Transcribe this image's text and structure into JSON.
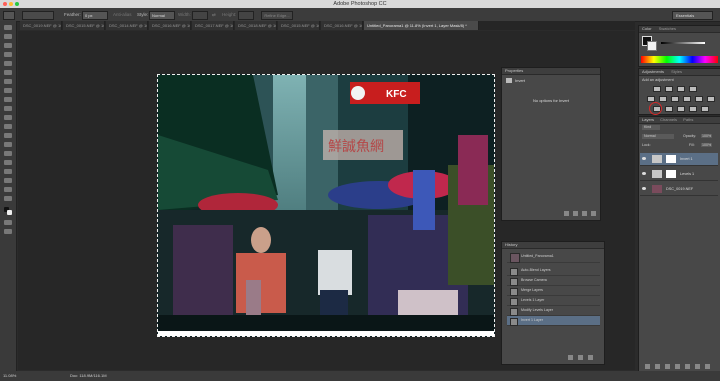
{
  "app": {
    "title": "Adobe Photoshop CC"
  },
  "options_bar": {
    "feather_label": "Feather:",
    "feather_value": "0 px",
    "antialias_label": "Anti-alias",
    "style_label": "Style:",
    "style_value": "Normal",
    "width_label": "Width:",
    "height_label": "Height:",
    "refine_edge_label": "Refine Edge...",
    "workspace": "Essentials"
  },
  "tabs": [
    {
      "label": "DSC_0019.NEF @ 16..."
    },
    {
      "label": "DSC_0015.NEF @ 16..."
    },
    {
      "label": "DSC_0014.NEF @ 16..."
    },
    {
      "label": "DSC_0016.NEF @ 16..."
    },
    {
      "label": "DSC_0017.NEF @ 16..."
    },
    {
      "label": "DSC_0018.NEF @ 16..."
    },
    {
      "label": "DSC_0015.NEF @ 16..."
    },
    {
      "label": "DSC_0016.NEF @ 16..."
    },
    {
      "label": "Untitled_Panorama1 @ 11.8% (Invert 1, Layer Mask/8) *"
    }
  ],
  "photo_signs": {
    "kfc": "KFC",
    "chinese_sign": "鮮誠魚網"
  },
  "properties_panel": {
    "tab": "Properties",
    "layer_type": "Invert",
    "message": "No options for Invert"
  },
  "history_panel": {
    "tab": "History",
    "snapshot": "Untitled_Panorama1",
    "items": [
      "Auto-Blend Layers",
      "Browse Camera",
      "Merge Layers",
      "Levels 1 Layer",
      "Modify Levels Layer",
      "Invert 1 Layer"
    ],
    "active_index": 5
  },
  "color_panel": {
    "tabs": [
      "Color",
      "Swatches"
    ]
  },
  "adjustments_panel": {
    "tabs": [
      "Adjustments",
      "Styles"
    ],
    "add_label": "Add an adjustment"
  },
  "layers_panel": {
    "tabs": [
      "Layers",
      "Channels",
      "Paths"
    ],
    "kind_label": "Kind",
    "blend_mode": "Normal",
    "opacity_label": "Opacity:",
    "opacity_value": "100%",
    "lock_label": "Lock:",
    "fill_label": "Fill:",
    "fill_value": "100%",
    "layers": [
      {
        "name": "Invert 1",
        "active": true
      },
      {
        "name": "Levels 1",
        "active": false
      },
      {
        "name": "DSC_0019.NEF",
        "active": false
      }
    ]
  },
  "status_bar": {
    "zoom": "11.08%",
    "doc_info": "Doc: 118.9M/116.1M"
  },
  "colors": {
    "accent": "#4a6a8a",
    "highlight_circle": "#d42a2a",
    "kfc_red": "#c81e1e"
  }
}
